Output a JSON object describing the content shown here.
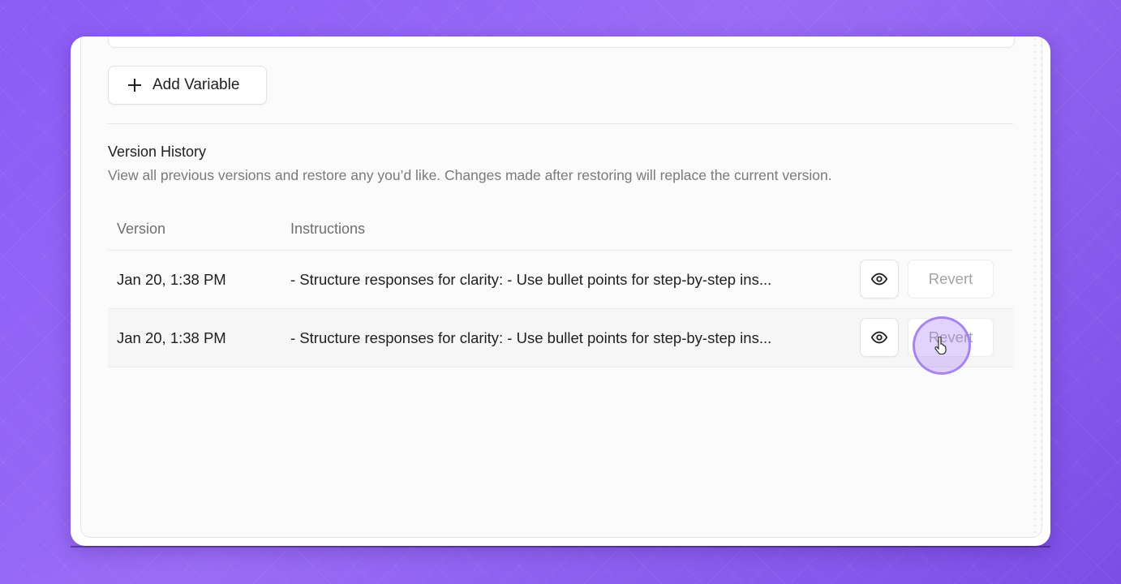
{
  "toolbar": {
    "add_variable_label": "Add Variable"
  },
  "version_history": {
    "title": "Version History",
    "description": "View all previous versions and restore any you’d like. Changes made after restoring will replace the current version.",
    "columns": {
      "version": "Version",
      "instructions": "Instructions"
    },
    "rows": [
      {
        "date": "Jan 20, 1:38 PM",
        "instructions": "- Structure responses for clarity: - Use bullet points for step-by-step ins...",
        "revert_label": "Revert"
      },
      {
        "date": "Jan 20, 1:38 PM",
        "instructions": "- Structure responses for clarity: - Use bullet points for step-by-step ins...",
        "revert_label": "Revert"
      }
    ]
  },
  "icons": {
    "add": "plus-icon",
    "view": "eye-icon",
    "cursor": "hand-pointer-icon"
  },
  "colors": {
    "background": "#8b5cf6",
    "cursor_highlight": "#a882f5"
  }
}
